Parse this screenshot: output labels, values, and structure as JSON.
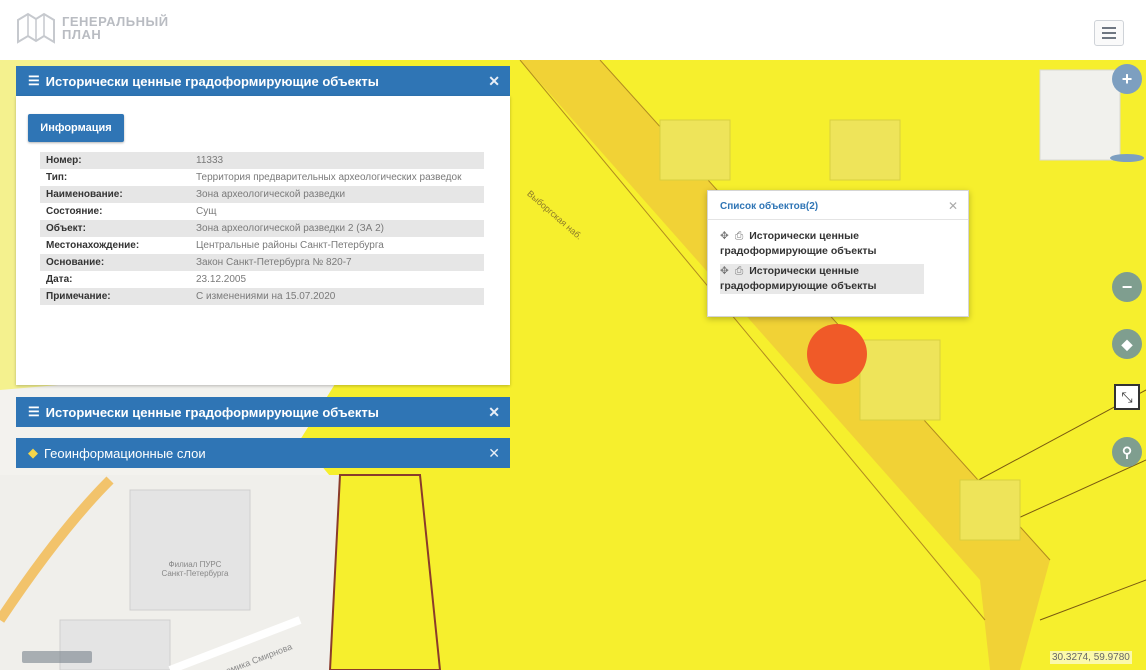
{
  "app": {
    "logo_line1": "ГЕНЕРАЛЬНЫЙ",
    "logo_line2": "ПЛАН"
  },
  "detail_panel": {
    "title": "Исторически ценные градоформирующие объекты",
    "info_button": "Информация",
    "rows": [
      {
        "key": "Номер:",
        "value": "11333"
      },
      {
        "key": "Тип:",
        "value": "Территория предварительных археологических разведок"
      },
      {
        "key": "Наименование:",
        "value": "Зона археологической разведки"
      },
      {
        "key": "Состояние:",
        "value": "Сущ"
      },
      {
        "key": "Объект:",
        "value": "Зона археологической разведки 2 (ЗА 2)"
      },
      {
        "key": "Местонахождение:",
        "value": "Центральные районы Санкт-Петербурга"
      },
      {
        "key": "Основание:",
        "value": "Закон Санкт-Петербурга № 820-7"
      },
      {
        "key": "Дата:",
        "value": "23.12.2005"
      },
      {
        "key": "Примечание:",
        "value": "С изменениями на 15.07.2020"
      }
    ]
  },
  "collapsed_panel": {
    "title": "Исторически ценные градоформирующие объекты"
  },
  "layers_panel": {
    "title": "Геоинформационные слои",
    "icon": "layers-icon"
  },
  "objects_popup": {
    "title": "Список объектов(2)",
    "items": [
      {
        "label": "Исторически ценные градоформирующие объекты"
      },
      {
        "label": "Исторически ценные градоформирующие объекты"
      }
    ]
  },
  "map": {
    "coords": "30.3274, 59.9780",
    "street_labels": [
      "Выборгская наб.",
      "ул. Академика Смирнова"
    ],
    "building_label": "Филиал ПУРС Санкт-Петербурга",
    "zone_color": "#f6ef2d",
    "marker_color": "#f05a28"
  },
  "controls": {
    "zoom_in": "+",
    "zoom_out": "−",
    "accent": "#2f75b5"
  }
}
